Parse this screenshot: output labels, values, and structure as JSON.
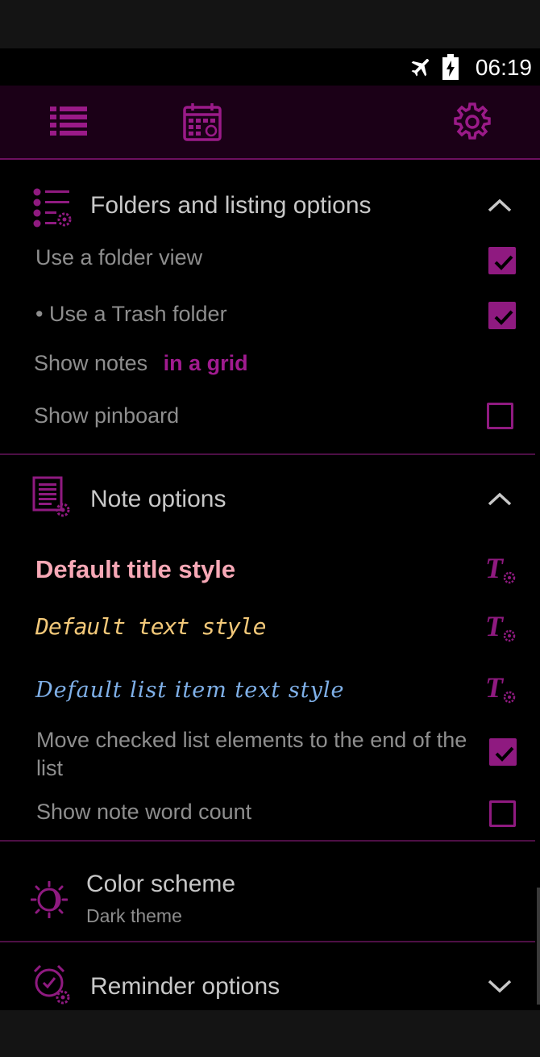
{
  "status": {
    "time": "06:19",
    "icons": [
      "airplane-icon",
      "battery-charging-icon"
    ]
  },
  "toolbar": {
    "icons": [
      "list-icon",
      "calendar-icon",
      "gear-icon"
    ],
    "accent": "#9a1a88"
  },
  "folders_section": {
    "title": "Folders and listing options",
    "use_folder_view": {
      "label": "Use a folder view",
      "checked": true
    },
    "use_trash": {
      "label": "• Use a Trash folder",
      "checked": true
    },
    "show_notes_label": "Show notes",
    "show_notes_value": "in a grid",
    "show_pinboard": {
      "label": "Show pinboard",
      "checked": false
    }
  },
  "note_section": {
    "title": "Note options",
    "default_title_style": "Default title style",
    "default_text_style": "Default text style",
    "default_list_item_text_style": "Default list item text style",
    "move_checked": {
      "label": "Move checked list elements to the end of the list",
      "checked": true
    },
    "word_count": {
      "label": "Show note word count",
      "checked": false
    }
  },
  "color_scheme": {
    "title": "Color scheme",
    "subtitle": "Dark theme"
  },
  "reminder_section": {
    "title": "Reminder options"
  },
  "colors": {
    "accent": "#8f1a80",
    "title_style": "#f7a8b6",
    "text_style": "#f2c879",
    "list_style": "#7fb0e8"
  }
}
